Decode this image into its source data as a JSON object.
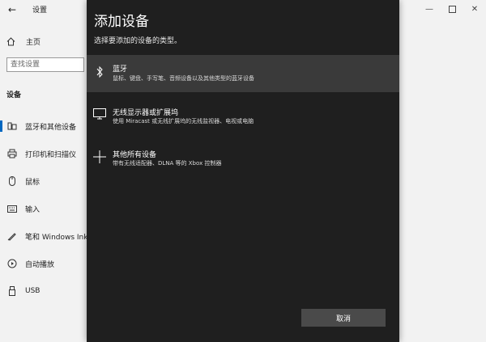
{
  "settings": {
    "title": "设置",
    "home_label": "主页",
    "search_placeholder": "查找设置",
    "section_label": "设备",
    "nav_items": [
      {
        "label": "蓝牙和其他设备",
        "icon": "bluetooth-devices-icon",
        "active": true
      },
      {
        "label": "打印机和扫描仪",
        "icon": "printer-icon"
      },
      {
        "label": "鼠标",
        "icon": "mouse-icon"
      },
      {
        "label": "输入",
        "icon": "keyboard-icon"
      },
      {
        "label": "笔和 Windows Ink",
        "icon": "pen-icon"
      },
      {
        "label": "自动播放",
        "icon": "autoplay-icon"
      },
      {
        "label": "USB",
        "icon": "usb-icon"
      }
    ]
  },
  "dialog": {
    "title": "添加设备",
    "subtitle": "选择要添加的设备的类型。",
    "options": [
      {
        "title": "蓝牙",
        "desc": "鼠标、键盘、手写笔、音频设备以及其他类型的蓝牙设备",
        "icon": "bluetooth-icon"
      },
      {
        "title": "无线显示器或扩展坞",
        "desc": "使用 Miracast 或无线扩展坞的无线监视器、电视或电脑",
        "icon": "monitor-icon"
      },
      {
        "title": "其他所有设备",
        "desc": "带有无线适配器、DLNA 等的 Xbox 控制器",
        "icon": "plus-icon"
      }
    ],
    "cancel_label": "取消"
  },
  "colors": {
    "dialog_bg": "#1f1f1f",
    "selected_option_bg": "#3a3a3a",
    "button_bg": "#4a4a4a",
    "settings_bg": "#f2f2f2",
    "accent": "#0067c0"
  }
}
